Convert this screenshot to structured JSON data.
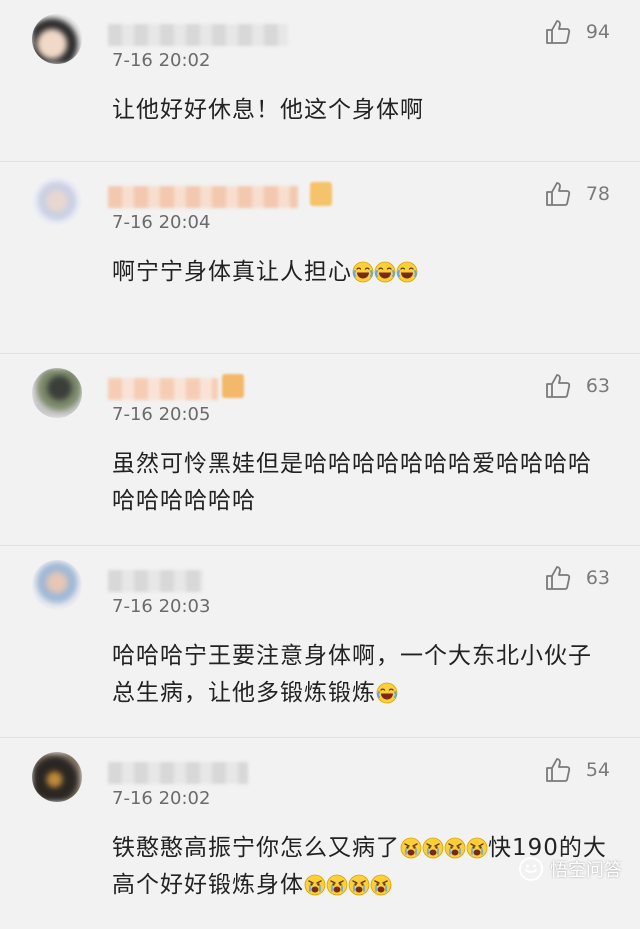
{
  "comments": [
    {
      "time": "7-16 20:02",
      "likes": "94",
      "text": "让他好好休息！他这个身体啊",
      "emoji": "",
      "emoji_count": 0
    },
    {
      "time": "7-16 20:04",
      "likes": "78",
      "text": "啊宁宁身体真让人担心",
      "emoji": "laughing-crying-emoji",
      "emoji_count": 3
    },
    {
      "time": "7-16 20:05",
      "likes": "63",
      "text": "虽然可怜黑娃但是哈哈哈哈哈哈哈爱哈哈哈哈哈哈哈哈哈哈",
      "emoji": "",
      "emoji_count": 0
    },
    {
      "time": "7-16 20:03",
      "likes": "63",
      "text": "哈哈哈宁王要注意身体啊，一个大东北小伙子总生病，让他多锻炼锻炼",
      "emoji": "laughing-crying-emoji",
      "emoji_count": 1
    },
    {
      "time": "7-16 20:02",
      "likes": "54",
      "text_part1": "铁憨憨高振宁你怎么又病了",
      "text_part2": "快190的大高个好好锻炼身体",
      "emoji": "angry-crying-emoji",
      "emoji_count_1": 4,
      "emoji_count_2": 4
    }
  ],
  "watermark": {
    "text": "悟空问答"
  },
  "colors": {
    "background": "#f2f2f2",
    "text": "#222222",
    "meta": "#6b6b6b"
  }
}
